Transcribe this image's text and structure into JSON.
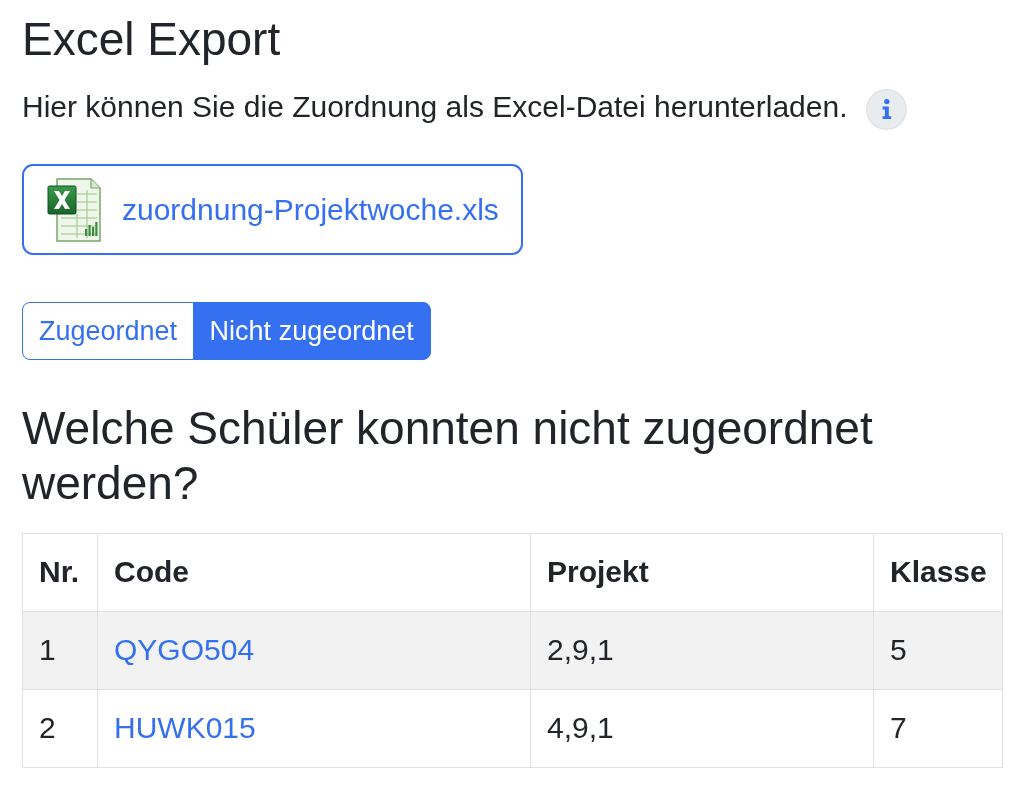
{
  "title": "Excel Export",
  "intro": "Hier können Sie die Zuordnung als Excel-Datei herunterladen.",
  "download": {
    "filename": "zuordnung-Projektwoche.xls"
  },
  "view_tabs": [
    {
      "label": "Zugeordnet",
      "selected": false
    },
    {
      "label": "Nicht zugeordnet",
      "selected": true
    }
  ],
  "section_title": "Welche Schüler konnten nicht zugeordnet werden?",
  "table": {
    "columns": [
      "Nr.",
      "Code",
      "Projekt",
      "Klasse"
    ],
    "rows": [
      {
        "nr": "1",
        "code": "QYGO504",
        "project": "2,9,1",
        "class": "5"
      },
      {
        "nr": "2",
        "code": "HUWK015",
        "project": "4,9,1",
        "class": "7"
      }
    ]
  }
}
